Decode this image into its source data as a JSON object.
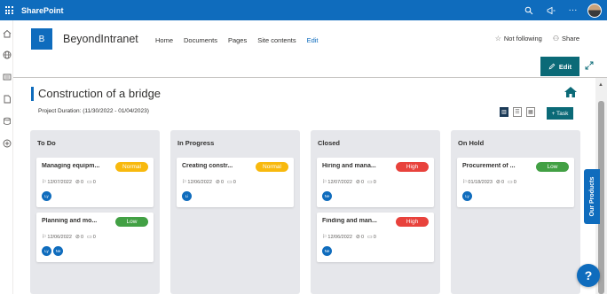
{
  "suite_bar": {
    "app_name": "SharePoint",
    "icons": [
      "waffle-icon",
      "help-icon",
      "megaphone-icon",
      "more-icon"
    ],
    "more_glyph": "···"
  },
  "site": {
    "logo_letter": "B",
    "title": "BeyondIntranet",
    "nav": [
      "Home",
      "Documents",
      "Pages",
      "Site contents",
      "Edit"
    ],
    "follow_label": "Not following",
    "share_label": "Share"
  },
  "command_bar": {
    "edit_label": "Edit"
  },
  "page": {
    "title": "Construction of a bridge",
    "duration": "Project Duration:  (11/30/2022 - 01/04/2023)",
    "task_button": "+ Task"
  },
  "colors": {
    "brand": "#0f6cbd",
    "teal": "#0b6a77",
    "normal": "#f8b90e",
    "low": "#42a044",
    "high": "#e8423c"
  },
  "board": {
    "columns": [
      {
        "title": "To Do",
        "cards": [
          {
            "title": "Managing equipm...",
            "priority": "Normal",
            "priority_color": "#f8b90e",
            "date": "12/07/2022",
            "attachments": "0",
            "comments": "0",
            "assignees": [
              "Ly"
            ]
          },
          {
            "title": "Planning and mo...",
            "priority": "Low",
            "priority_color": "#42a044",
            "date": "12/06/2022",
            "attachments": "0",
            "comments": "0",
            "assignees": [
              "Ly",
              "Ne"
            ]
          }
        ]
      },
      {
        "title": "In Progress",
        "cards": [
          {
            "title": "Creating constr...",
            "priority": "Normal",
            "priority_color": "#f8b90e",
            "date": "12/06/2022",
            "attachments": "0",
            "comments": "0",
            "assignees": [
              "Li"
            ]
          }
        ]
      },
      {
        "title": "Closed",
        "cards": [
          {
            "title": "Hiring and mana...",
            "priority": "High",
            "priority_color": "#e8423c",
            "date": "12/07/2022",
            "attachments": "0",
            "comments": "0",
            "assignees": [
              "Ne"
            ]
          },
          {
            "title": "Finding and man...",
            "priority": "High",
            "priority_color": "#e8423c",
            "date": "12/06/2022",
            "attachments": "0",
            "comments": "0",
            "assignees": [
              "Ne"
            ]
          }
        ]
      },
      {
        "title": "On Hold",
        "cards": [
          {
            "title": "Procurement of ...",
            "priority": "Low",
            "priority_color": "#42a044",
            "date": "01/18/2023",
            "attachments": "0",
            "comments": "0",
            "assignees": [
              "Ly"
            ]
          }
        ]
      }
    ]
  },
  "floating": {
    "products_tab": "Our Products",
    "help": "?"
  }
}
